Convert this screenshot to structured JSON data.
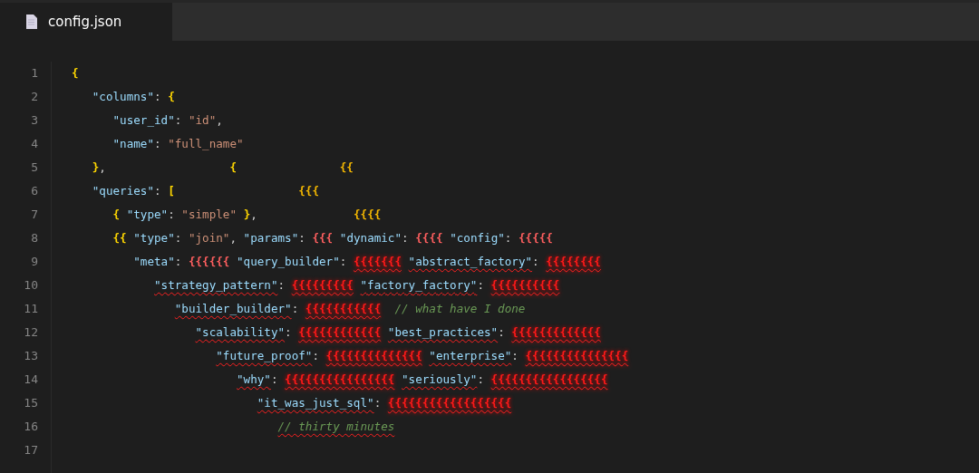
{
  "tab": {
    "title": "config.json",
    "selected": true
  },
  "lines": [
    {
      "number": "1",
      "tokens": [
        {
          "kind": "bracket",
          "text": "{"
        }
      ]
    },
    {
      "number": "2",
      "tokens": [
        {
          "kind": "key",
          "text": "   \"columns\""
        },
        {
          "kind": "punct",
          "text": ": "
        },
        {
          "kind": "bracket",
          "text": "{"
        }
      ]
    },
    {
      "number": "3",
      "tokens": [
        {
          "kind": "key",
          "text": "      \"user_id\""
        },
        {
          "kind": "punct",
          "text": ": "
        },
        {
          "kind": "string",
          "text": "\"id\""
        },
        {
          "kind": "punct",
          "text": ","
        }
      ]
    },
    {
      "number": "4",
      "tokens": [
        {
          "kind": "key",
          "text": "      \"name\""
        },
        {
          "kind": "punct",
          "text": ": "
        },
        {
          "kind": "string",
          "text": "\"full_name\""
        }
      ]
    },
    {
      "number": "5",
      "tokens": [
        {
          "kind": "bracket",
          "text": "   }"
        },
        {
          "kind": "punct",
          "text": ","
        },
        {
          "kind": "bracket",
          "text": "                  {"
        },
        {
          "kind": "bracket-stray",
          "text": "               {{"
        }
      ]
    },
    {
      "number": "6",
      "tokens": [
        {
          "kind": "key",
          "text": "   \"queries\""
        },
        {
          "kind": "punct",
          "text": ": "
        },
        {
          "kind": "bracket",
          "text": "["
        },
        {
          "kind": "bracket-stray",
          "text": "                  {{{"
        }
      ]
    },
    {
      "number": "7",
      "tokens": [
        {
          "kind": "bracket",
          "text": "      {"
        },
        {
          "kind": "key",
          "text": " \"type\""
        },
        {
          "kind": "punct",
          "text": ": "
        },
        {
          "kind": "string",
          "text": "\"simple\""
        },
        {
          "kind": "bracket",
          "text": " }"
        },
        {
          "kind": "punct",
          "text": ","
        },
        {
          "kind": "bracket-stray",
          "text": "              {{{{"
        }
      ]
    },
    {
      "number": "8",
      "tokens": [
        {
          "kind": "bracket",
          "text": "      {{"
        },
        {
          "kind": "key",
          "text": " \"type\""
        },
        {
          "kind": "punct",
          "text": ": "
        },
        {
          "kind": "string",
          "text": "\"join\""
        },
        {
          "kind": "punct",
          "text": ", "
        },
        {
          "kind": "key",
          "text": "\"params\""
        },
        {
          "kind": "punct",
          "text": ": "
        },
        {
          "kind": "bracket-red",
          "text": "{{{"
        },
        {
          "kind": "key",
          "text": " \"dynamic\""
        },
        {
          "kind": "punct",
          "text": ": "
        },
        {
          "kind": "bracket-red",
          "text": "{{{{"
        },
        {
          "kind": "key",
          "text": " \"config\""
        },
        {
          "kind": "punct",
          "text": ": "
        },
        {
          "kind": "bracket-red",
          "text": "{{{{{"
        }
      ]
    },
    {
      "number": "9",
      "tokens": [
        {
          "kind": "key",
          "text": "         \"meta\""
        },
        {
          "kind": "punct",
          "text": ": "
        },
        {
          "kind": "bracket-red",
          "text": "{{{{{{"
        },
        {
          "kind": "key",
          "text": " \"query_builder\""
        },
        {
          "kind": "punct",
          "text": ": "
        },
        {
          "kind": "bracket-error",
          "text": "{{{{{{{"
        },
        {
          "kind": "key-error",
          "text": " \"abstract_factory\""
        },
        {
          "kind": "punct",
          "text": ": "
        },
        {
          "kind": "bracket-error",
          "text": "{{{{{{{{"
        }
      ]
    },
    {
      "number": "10",
      "tokens": [
        {
          "kind": "key-error",
          "text": "            \"strategy_pattern\""
        },
        {
          "kind": "punct",
          "text": ": "
        },
        {
          "kind": "bracket-error",
          "text": "{{{{{{{{{"
        },
        {
          "kind": "key-error",
          "text": " \"factory_factory\""
        },
        {
          "kind": "punct",
          "text": ": "
        },
        {
          "kind": "bracket-error",
          "text": "{{{{{{{{{{"
        }
      ]
    },
    {
      "number": "11",
      "tokens": [
        {
          "kind": "key-error",
          "text": "               \"builder_builder\""
        },
        {
          "kind": "punct",
          "text": ": "
        },
        {
          "kind": "bracket-error",
          "text": "{{{{{{{{{{{"
        },
        {
          "kind": "comment",
          "text": "  // what have I done"
        }
      ]
    },
    {
      "number": "12",
      "tokens": [
        {
          "kind": "key-error",
          "text": "                  \"scalability\""
        },
        {
          "kind": "punct",
          "text": ": "
        },
        {
          "kind": "bracket-error",
          "text": "{{{{{{{{{{{{"
        },
        {
          "kind": "key-error",
          "text": " \"best_practices\""
        },
        {
          "kind": "punct",
          "text": ": "
        },
        {
          "kind": "bracket-error",
          "text": "{{{{{{{{{{{{{"
        }
      ]
    },
    {
      "number": "13",
      "tokens": [
        {
          "kind": "key-error",
          "text": "                     \"future_proof\""
        },
        {
          "kind": "punct",
          "text": ": "
        },
        {
          "kind": "bracket-error",
          "text": "{{{{{{{{{{{{{{"
        },
        {
          "kind": "key-error",
          "text": " \"enterprise\""
        },
        {
          "kind": "punct",
          "text": ": "
        },
        {
          "kind": "bracket-error",
          "text": "{{{{{{{{{{{{{{{"
        }
      ]
    },
    {
      "number": "14",
      "tokens": [
        {
          "kind": "key-error",
          "text": "                        \"why\""
        },
        {
          "kind": "punct",
          "text": ": "
        },
        {
          "kind": "bracket-error",
          "text": "{{{{{{{{{{{{{{{{"
        },
        {
          "kind": "key-error",
          "text": " \"seriously\""
        },
        {
          "kind": "punct",
          "text": ": "
        },
        {
          "kind": "bracket-error",
          "text": "{{{{{{{{{{{{{{{{{"
        }
      ]
    },
    {
      "number": "15",
      "tokens": [
        {
          "kind": "key-error",
          "text": "                           \"it_was_just_sql\""
        },
        {
          "kind": "punct",
          "text": ": "
        },
        {
          "kind": "bracket-error",
          "text": "{{{{{{{{{{{{{{{{{{"
        }
      ]
    },
    {
      "number": "16",
      "tokens": [
        {
          "kind": "comment-error",
          "text": "                              // thirty minutes"
        }
      ]
    },
    {
      "number": "17"
    }
  ]
}
